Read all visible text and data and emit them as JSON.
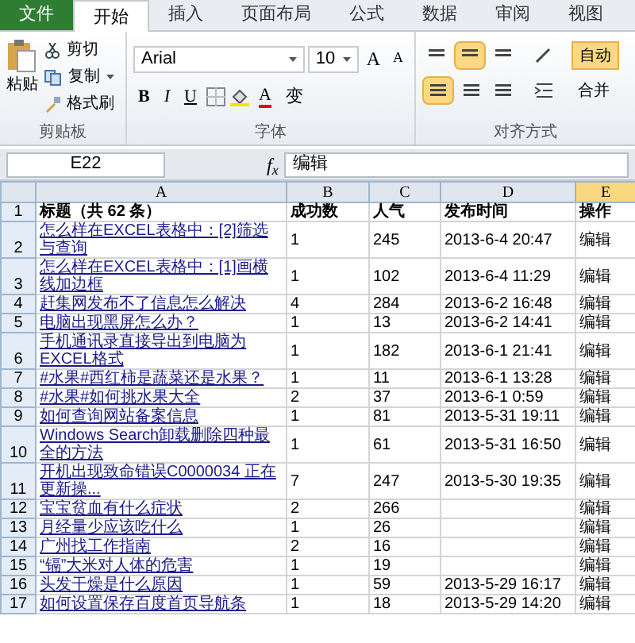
{
  "tabs": [
    {
      "label": "文件",
      "kind": "file",
      "selected": false
    },
    {
      "label": "开始",
      "kind": "tab",
      "selected": true
    },
    {
      "label": "插入",
      "kind": "tab",
      "selected": false
    },
    {
      "label": "页面布局",
      "kind": "tab",
      "selected": false
    },
    {
      "label": "公式",
      "kind": "tab",
      "selected": false
    },
    {
      "label": "数据",
      "kind": "tab",
      "selected": false
    },
    {
      "label": "审阅",
      "kind": "tab",
      "selected": false
    },
    {
      "label": "视图",
      "kind": "tab",
      "selected": false
    }
  ],
  "clipboard": {
    "paste": "粘贴",
    "cut": "剪切",
    "copy": "复制",
    "painter": "格式刷",
    "label": "剪贴板"
  },
  "font": {
    "name": "Arial",
    "size": "10",
    "grow": "A",
    "shrink": "A",
    "bold": "B",
    "italic": "I",
    "underline": "U",
    "color_letter": "A",
    "phonetic": "变",
    "label": "字体"
  },
  "alignment": {
    "vertical": [
      {
        "selected": false
      },
      {
        "selected": true
      },
      {
        "selected": false
      }
    ],
    "horizontal": [
      {
        "selected": true
      },
      {
        "selected": false
      },
      {
        "selected": false
      }
    ],
    "wrap": "自动",
    "merge": "合并",
    "label": "对齐方式"
  },
  "formula_bar": {
    "name_box": "E22",
    "function_label": "f$_{x}$",
    "value": "编辑"
  },
  "columns": [
    {
      "label": "A",
      "selected": false
    },
    {
      "label": "B",
      "selected": false
    },
    {
      "label": "C",
      "selected": false
    },
    {
      "label": "D",
      "selected": false
    },
    {
      "label": "E",
      "selected": true
    }
  ],
  "rows": [
    {
      "header": "1",
      "kind": "header",
      "a": "标题（共 62 条）",
      "b": "成功数",
      "c": "人气",
      "d": "发布时间",
      "e": "操作"
    },
    {
      "header": "2",
      "kind": "link",
      "a": "怎么样在EXCEL表格中：[2]筛选与查询",
      "b": "1",
      "c": "245",
      "d": "2013-6-4 20:47",
      "e": "编辑"
    },
    {
      "header": "3",
      "kind": "link",
      "a": "怎么样在EXCEL表格中：[1]画横线加边框",
      "b": "1",
      "c": "102",
      "d": "2013-6-4 11:29",
      "e": "编辑"
    },
    {
      "header": "4",
      "kind": "link",
      "a": "赶集网发布不了信息怎么解决",
      "b": "4",
      "c": "284",
      "d": "2013-6-2 16:48",
      "e": "编辑"
    },
    {
      "header": "5",
      "kind": "link",
      "a": "电脑出现黑屏怎么办？",
      "b": "1",
      "c": "13",
      "d": "2013-6-2 14:41",
      "e": "编辑"
    },
    {
      "header": "6",
      "kind": "link",
      "a": "手机通讯录直接导出到电脑为EXCEL格式",
      "b": "1",
      "c": "182",
      "d": "2013-6-1 21:41",
      "e": "编辑"
    },
    {
      "header": "7",
      "kind": "link",
      "a": "#水果#西红柿是蔬菜还是水果？",
      "b": "1",
      "c": "11",
      "d": "2013-6-1 13:28",
      "e": "编辑"
    },
    {
      "header": "8",
      "kind": "link",
      "a": "#水果#如何挑水果大全",
      "b": "2",
      "c": "37",
      "d": "2013-6-1 0:59",
      "e": "编辑"
    },
    {
      "header": "9",
      "kind": "link",
      "a": "如何查询网站备案信息",
      "b": "1",
      "c": "81",
      "d": "2013-5-31 19:11",
      "e": "编辑"
    },
    {
      "header": "10",
      "kind": "link",
      "a": "Windows Search卸载删除四种最全的方法",
      "b": "1",
      "c": "61",
      "d": "2013-5-31 16:50",
      "e": "编辑"
    },
    {
      "header": "11",
      "kind": "link",
      "a": "开机出现致命错误C0000034 正在更新操...",
      "b": "7",
      "c": "247",
      "d": "2013-5-30 19:35",
      "e": "编辑"
    },
    {
      "header": "12",
      "kind": "link",
      "a": "宝宝贫血有什么症状",
      "b": "2",
      "c": "266",
      "e": "编辑"
    },
    {
      "header": "13",
      "kind": "link",
      "a": "月经量少应该吃什么",
      "b": "1",
      "c": "26",
      "e": "编辑"
    },
    {
      "header": "14",
      "kind": "link",
      "a": "广州找工作指南",
      "b": "2",
      "c": "16",
      "e": "编辑"
    },
    {
      "header": "15",
      "kind": "link",
      "a": "“镉”大米对人体的危害",
      "b": "1",
      "c": "19",
      "e": "编辑"
    },
    {
      "header": "16",
      "kind": "link",
      "a": "头发干燥是什么原因",
      "b": "1",
      "c": "59",
      "d": "2013-5-29 16:17",
      "e": "编辑"
    },
    {
      "header": "17",
      "kind": "link",
      "a": "如何设置保存百度首页导航条",
      "b": "1",
      "c": "18",
      "d": "2013-5-29 14:20",
      "e": "编辑"
    }
  ]
}
